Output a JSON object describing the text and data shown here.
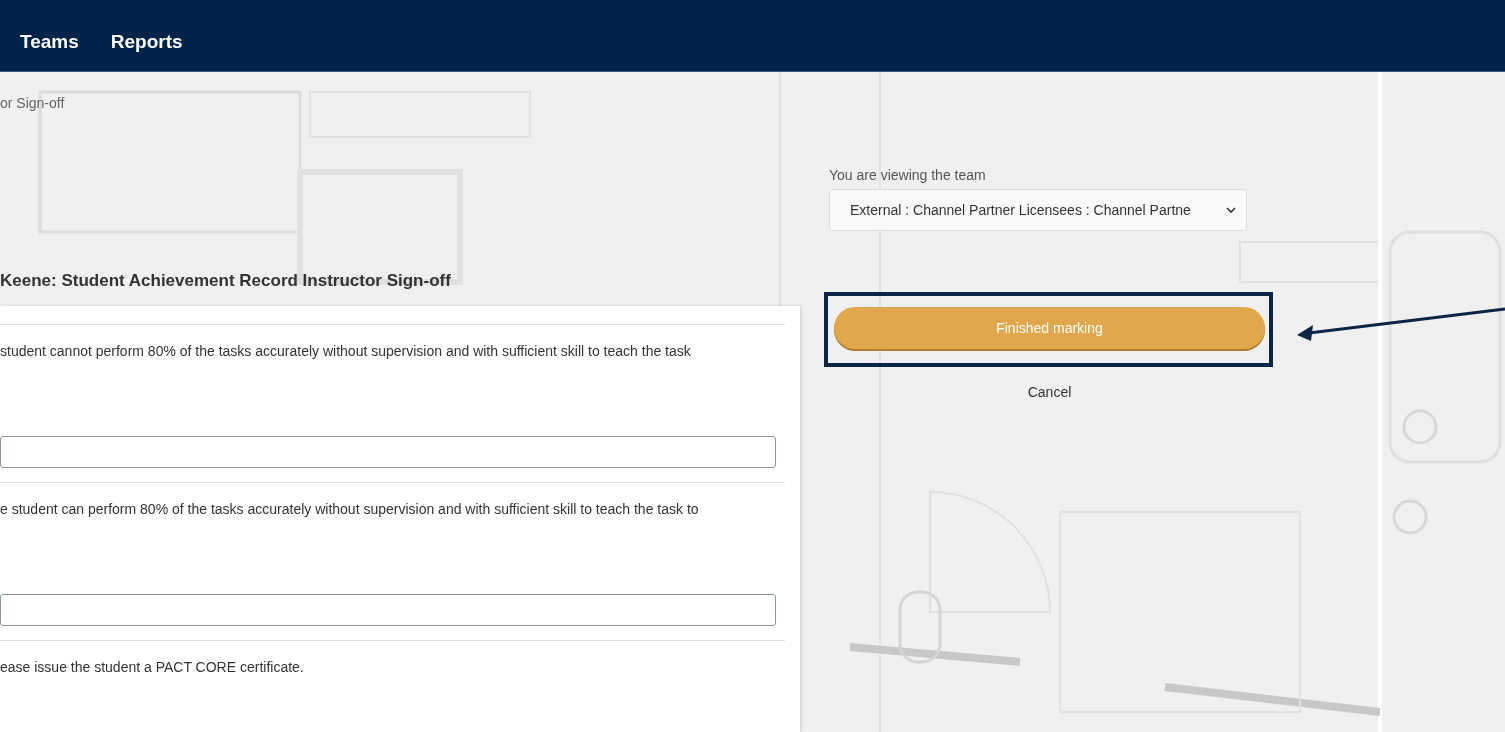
{
  "nav": {
    "items": [
      {
        "label": "Teams"
      },
      {
        "label": "Reports"
      }
    ]
  },
  "breadcrumb": "or Sign-off",
  "form": {
    "title": "Keene: Student Achievement Record Instructor Sign-off",
    "questions": [
      {
        "kind": "text-answer",
        "text": "student cannot perform 80% of the tasks accurately without supervision and with sufficient skill to teach the task"
      },
      {
        "kind": "text-answer",
        "text": "e student can perform 80% of the tasks accurately without supervision and with sufficient skill to teach the task to"
      },
      {
        "kind": "statement",
        "text": "ease issue the student a PACT CORE certificate."
      }
    ]
  },
  "team_selector": {
    "label": "You are viewing the team",
    "value": "External : Channel Partner Licensees : Channel Partne"
  },
  "actions": {
    "primary": "Finished marking",
    "cancel": "Cancel"
  }
}
